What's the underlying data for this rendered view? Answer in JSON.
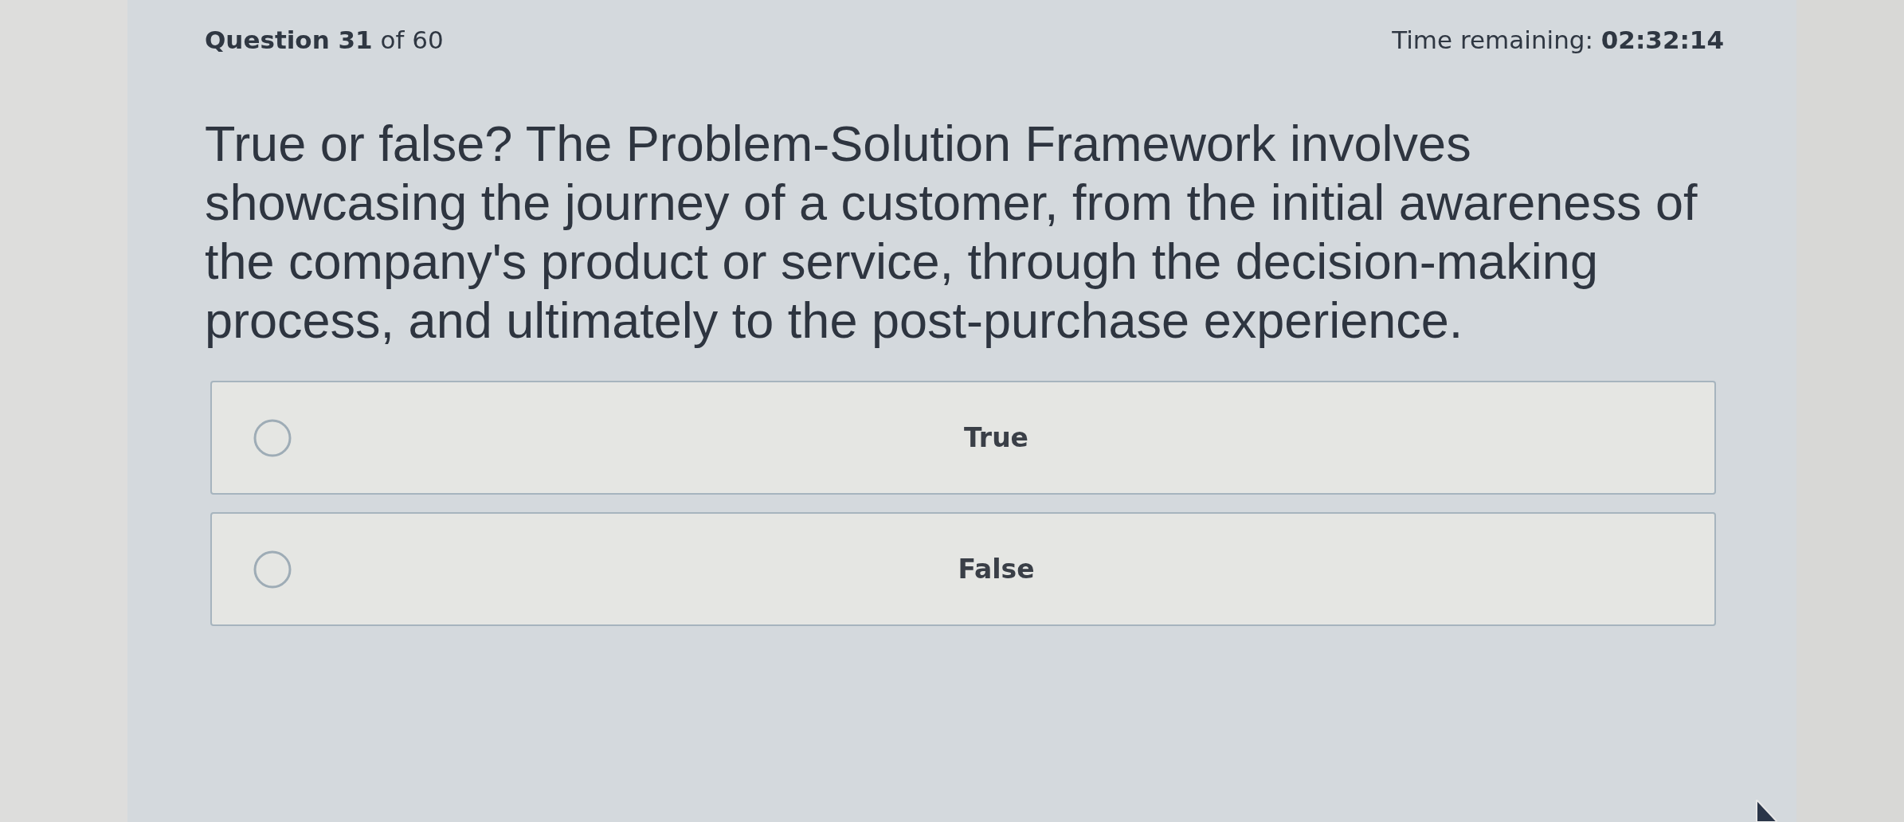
{
  "header": {
    "progress": "**Question 31** of 60",
    "timer": "Time remaining: **02:32:14**"
  },
  "question": {
    "text": "True or false? The Problem-Solution Framework involves showcasing the journey of a customer, from the initial awareness of the company's product or service, through the decision-making process, and ultimately to the post-purchase experience."
  },
  "options": [
    {
      "label": "True",
      "selected": false
    },
    {
      "label": "False",
      "selected": false
    }
  ]
}
